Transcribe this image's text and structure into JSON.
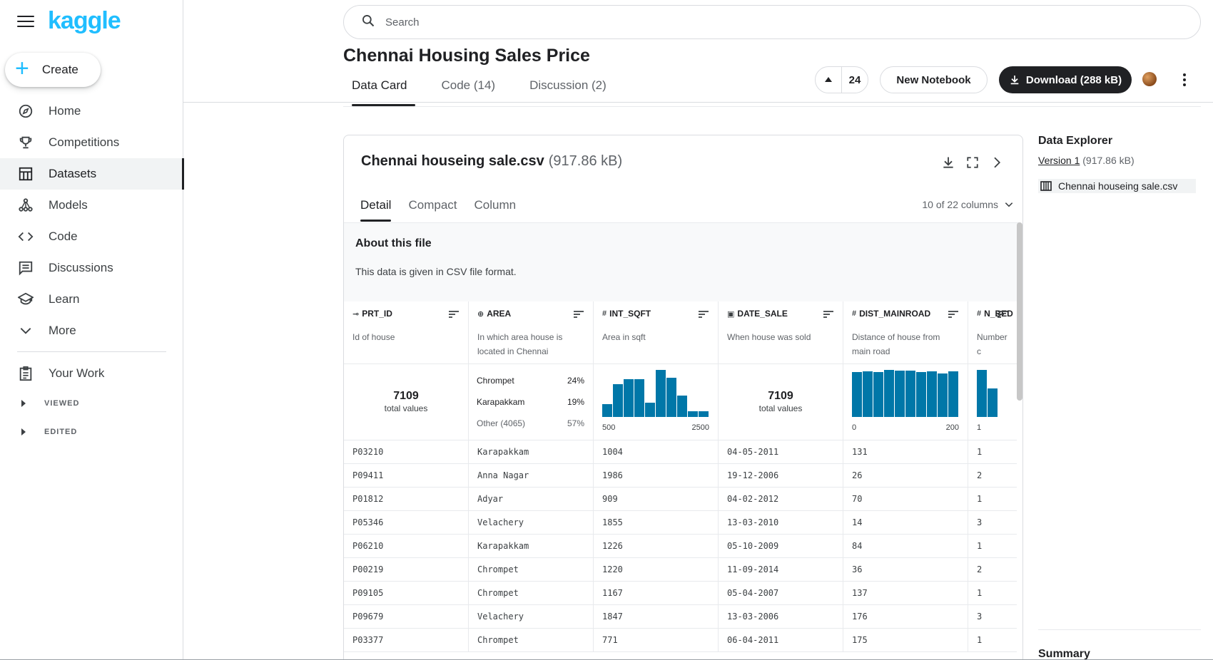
{
  "brand": {
    "logo": "kaggle",
    "accent": "#20beff"
  },
  "sidebar": {
    "create_label": "Create",
    "items": [
      {
        "label": "Home",
        "icon": "compass-icon"
      },
      {
        "label": "Competitions",
        "icon": "trophy-icon"
      },
      {
        "label": "Datasets",
        "icon": "table-icon",
        "active": true
      },
      {
        "label": "Models",
        "icon": "models-icon"
      },
      {
        "label": "Code",
        "icon": "code-icon"
      },
      {
        "label": "Discussions",
        "icon": "chat-icon"
      },
      {
        "label": "Learn",
        "icon": "school-icon"
      },
      {
        "label": "More",
        "icon": "chevron-down-icon"
      }
    ],
    "your_work": "Your Work",
    "viewed": "VIEWED",
    "edited": "EDITED"
  },
  "search": {
    "placeholder": "Search"
  },
  "header": {
    "title": "Chennai Housing Sales Price",
    "tabs": [
      "Data Card",
      "Code (14)",
      "Discussion (2)"
    ],
    "votes": "24",
    "new_notebook": "New Notebook",
    "download": "Download (288 kB)"
  },
  "file": {
    "name": "Chennai houseing sale.csv",
    "size": "(917.86 kB)",
    "tabs": [
      "Detail",
      "Compact",
      "Column"
    ],
    "column_count": "10 of 22 columns",
    "about_title": "About this file",
    "about_text": "This data is given in CSV file format."
  },
  "columns": [
    {
      "type": "id",
      "name": "PRT_ID",
      "desc": "Id of house",
      "viz": "total",
      "total": "7109",
      "total_label": "total values"
    },
    {
      "type": "string",
      "name": "AREA",
      "desc": "In which area house is located in Chennai",
      "viz": "categories",
      "categories": [
        {
          "label": "Chrompet",
          "pct": "24%"
        },
        {
          "label": "Karapakkam",
          "pct": "19%"
        },
        {
          "label": "Other (4065)",
          "pct": "57%"
        }
      ]
    },
    {
      "type": "number",
      "name": "INT_SQFT",
      "desc": "Area in sqft",
      "viz": "histogram",
      "hist": {
        "min_label": "500",
        "max_label": "2500",
        "values": [
          0.28,
          0.7,
          0.8,
          0.8,
          0.3,
          1.0,
          0.84,
          0.45,
          0.12,
          0.12
        ]
      }
    },
    {
      "type": "date",
      "name": "DATE_SALE",
      "desc": "When house was sold",
      "viz": "total",
      "total": "7109",
      "total_label": "total values"
    },
    {
      "type": "number",
      "name": "DIST_MAINROAD",
      "desc": "Distance of house from main road",
      "viz": "histogram",
      "hist": {
        "min_label": "0",
        "max_label": "200",
        "values": [
          0.95,
          0.97,
          0.95,
          1.0,
          0.98,
          0.98,
          0.95,
          0.97,
          0.93,
          0.97
        ]
      }
    },
    {
      "type": "number",
      "name": "N_BED",
      "desc": "Number c",
      "viz": "histogram",
      "hist": {
        "min_label": "1",
        "max_label": "",
        "values": [
          1.0,
          0.6
        ]
      }
    }
  ],
  "rows": [
    [
      "P03210",
      "Karapakkam",
      "1004",
      "04-05-2011",
      "131",
      "1"
    ],
    [
      "P09411",
      "Anna Nagar",
      "1986",
      "19-12-2006",
      "26",
      "2"
    ],
    [
      "P01812",
      "Adyar",
      "909",
      "04-02-2012",
      "70",
      "1"
    ],
    [
      "P05346",
      "Velachery",
      "1855",
      "13-03-2010",
      "14",
      "3"
    ],
    [
      "P06210",
      "Karapakkam",
      "1226",
      "05-10-2009",
      "84",
      "1"
    ],
    [
      "P00219",
      "Chrompet",
      "1220",
      "11-09-2014",
      "36",
      "2"
    ],
    [
      "P09105",
      "Chrompet",
      "1167",
      "05-04-2007",
      "137",
      "1"
    ],
    [
      "P09679",
      "Velachery",
      "1847",
      "13-03-2006",
      "176",
      "3"
    ],
    [
      "P03377",
      "Chrompet",
      "771",
      "06-04-2011",
      "175",
      "1"
    ]
  ],
  "explorer": {
    "title": "Data Explorer",
    "version_link": "Version 1",
    "version_size": "(917.86 kB)",
    "file": "Chennai houseing sale.csv",
    "summary": "Summary"
  },
  "colors": {
    "histogram": "#0077a8",
    "dark": "#202124"
  }
}
